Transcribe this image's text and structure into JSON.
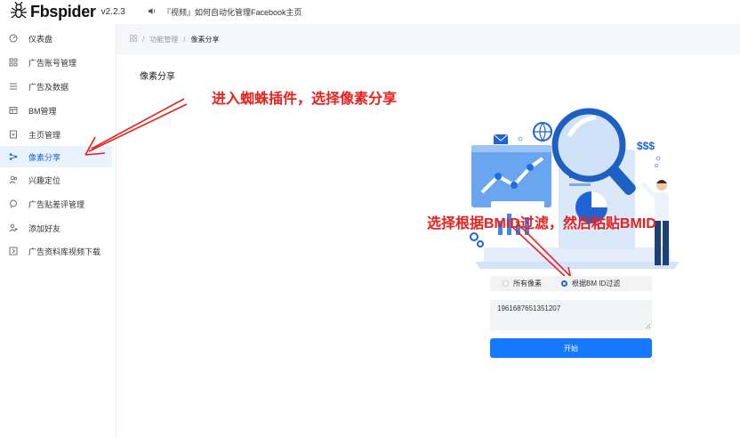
{
  "header": {
    "app_name": "Fbspider",
    "version": "v2.2.3",
    "notice": "『视频』如何自动化管理Facebook主页"
  },
  "sidebar": {
    "items": [
      {
        "label": "仪表盘",
        "icon": "dashboard-icon"
      },
      {
        "label": "广告账号管理",
        "icon": "grid-icon"
      },
      {
        "label": "广告及数据",
        "icon": "list-icon"
      },
      {
        "label": "BM管理",
        "icon": "table-icon"
      },
      {
        "label": "主页管理",
        "icon": "page-icon"
      },
      {
        "label": "像素分享",
        "icon": "share-icon",
        "active": true
      },
      {
        "label": "兴趣定位",
        "icon": "users-icon"
      },
      {
        "label": "广告贴差评管理",
        "icon": "comment-icon"
      },
      {
        "label": "添加好友",
        "icon": "user-add-icon"
      },
      {
        "label": "广告资料库视频下载",
        "icon": "download-icon"
      }
    ]
  },
  "breadcrumb": {
    "items": [
      "功能管理",
      "像素分享"
    ]
  },
  "page": {
    "title": "像素分享"
  },
  "annotations": {
    "top": "进入蜘蛛插件，选择像素分享",
    "middle": "选择根据BMID过滤，然后粘贴BMID"
  },
  "illustration": {
    "money": "$$$"
  },
  "form": {
    "radio_all": "所有像素",
    "radio_bm": "根据BM ID过滤",
    "selected": "radio_bm",
    "bm_id_value": "1961687651351207",
    "start_label": "开始"
  },
  "colors": {
    "accent": "#1677ff",
    "annotation": "#e8211e",
    "active_bg": "#e9f2ff"
  }
}
